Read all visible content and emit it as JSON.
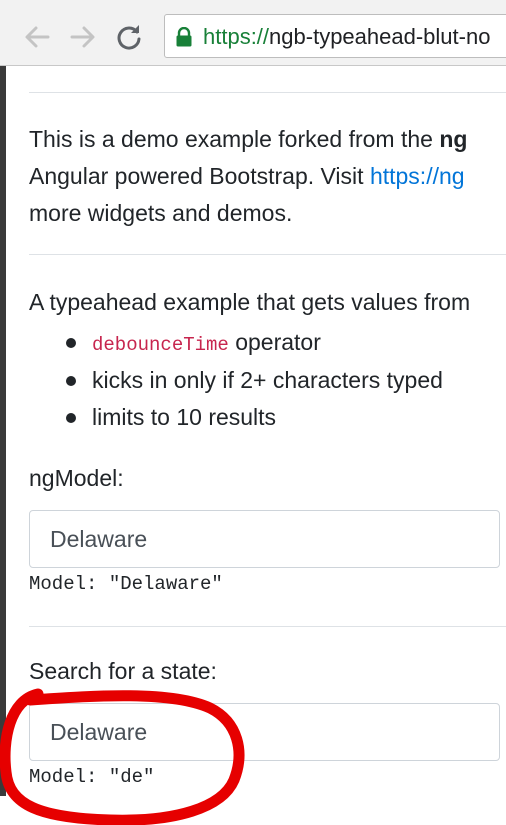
{
  "browser": {
    "url_scheme": "https://",
    "url_rest": "ngb-typeahead-blut-no"
  },
  "intro": {
    "line1_text": "This is a demo example forked from the ",
    "line1_bold": "ng",
    "line2_text": "Angular powered Bootstrap. Visit ",
    "line2_link": "https://ng",
    "line3_text": "more widgets and demos."
  },
  "description": {
    "intro": "A typeahead example that gets values from",
    "features": [
      {
        "code": "debounceTime",
        "text": " operator"
      },
      {
        "code": "",
        "text": "kicks in only if 2+ characters typed"
      },
      {
        "code": "",
        "text": "limits to 10 results"
      }
    ]
  },
  "ngmodel_section": {
    "label": "ngModel:",
    "input_value": "Delaware",
    "model_text": "Model: \"Delaware\""
  },
  "search_section": {
    "label": "Search for a state:",
    "input_value": "Delaware",
    "model_text": "Model: \"de\""
  },
  "colors": {
    "link": "#0275d8",
    "code": "#c7254e",
    "annotation": "#e60000",
    "secure": "#188038"
  }
}
